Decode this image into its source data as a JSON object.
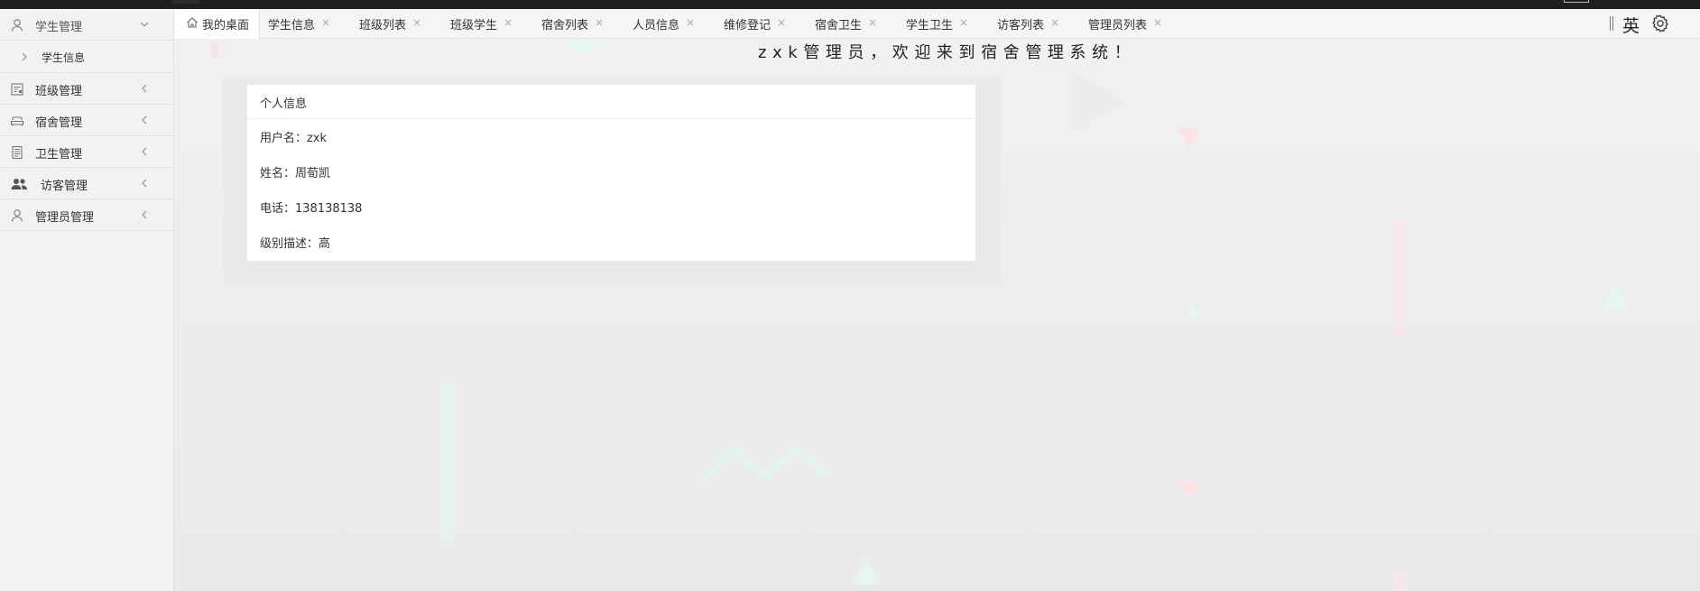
{
  "sidebar": {
    "items": [
      {
        "label": "学生管理",
        "icon": "user-icon",
        "state": "expanded"
      },
      {
        "label": "学生信息",
        "icon": "chevron-right-icon",
        "state": "sub-item"
      },
      {
        "label": "班级管理",
        "icon": "class-icon",
        "state": "collapsed"
      },
      {
        "label": "宿舍管理",
        "icon": "sofa-icon",
        "state": "collapsed"
      },
      {
        "label": "卫生管理",
        "icon": "document-icon",
        "state": "collapsed"
      },
      {
        "label": "访客管理",
        "icon": "users-icon",
        "state": "collapsed"
      },
      {
        "label": "管理员管理",
        "icon": "user-icon",
        "state": "collapsed"
      }
    ]
  },
  "tabs": [
    {
      "label": "我的桌面",
      "active": true
    },
    {
      "label": "学生信息"
    },
    {
      "label": "班级列表"
    },
    {
      "label": "班级学生"
    },
    {
      "label": "宿舍列表"
    },
    {
      "label": "人员信息"
    },
    {
      "label": "维修登记"
    },
    {
      "label": "宿舍卫生"
    },
    {
      "label": "学生卫生"
    },
    {
      "label": "访客列表"
    },
    {
      "label": "管理员列表"
    }
  ],
  "tab_close_glyph": "×",
  "toolbar": {
    "lang_label": "英",
    "settings_icon": "gear-icon"
  },
  "welcome": "zxk管理员，欢迎来到宿舍管理系统！",
  "card": {
    "title": "个人信息",
    "rows": [
      {
        "label": "用户名：",
        "value": "zxk"
      },
      {
        "label": "姓名：",
        "value": "周荀凯"
      },
      {
        "label": "电话：",
        "value": "138138138"
      },
      {
        "label": "级别描述：",
        "value": "高"
      }
    ]
  },
  "colors": {
    "accent": "#333333",
    "sidebar_bg": "#f2f2f2",
    "active_tab_bg": "#ffffff"
  }
}
